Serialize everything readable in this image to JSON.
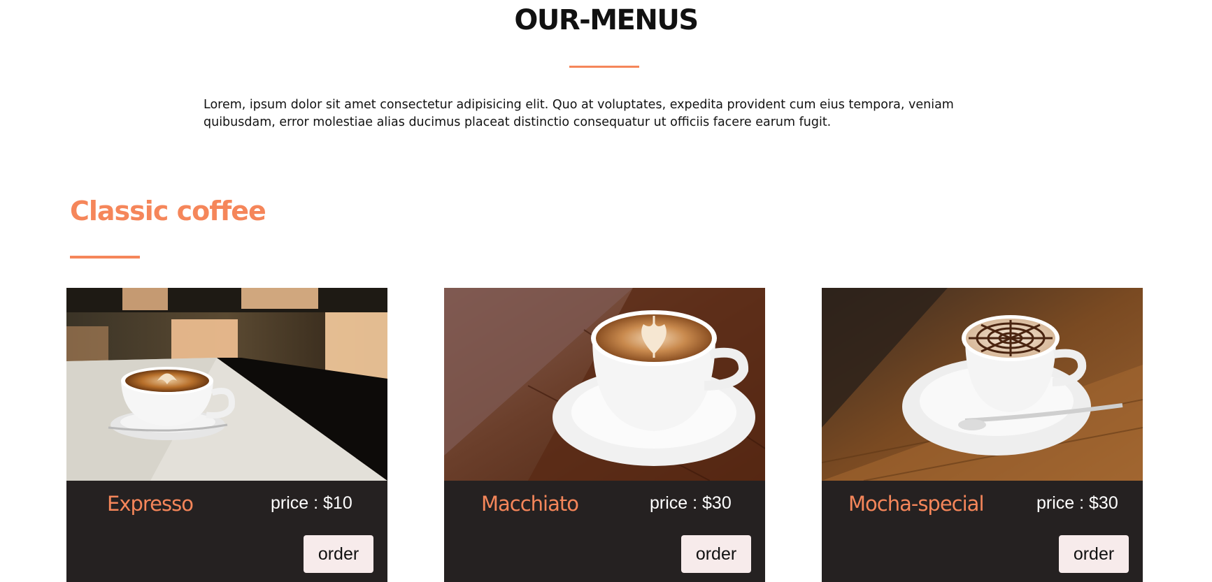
{
  "section": {
    "title": "OUR-MENUS",
    "intro": "Lorem, ipsum dolor sit amet consectetur adipisicing elit. Quo at voluptates, expedita provident cum eius tempora, veniam quibusdam, error molestiae alias ducimus placeat distinctio consequatur ut officiis facere earum fugit."
  },
  "category": {
    "title": "Classic coffee",
    "items": [
      {
        "name": "Expresso",
        "price": "price : $10",
        "order_label": "order",
        "image": "espresso-latte-art-cup-photo"
      },
      {
        "name": "Macchiato",
        "price": "price : $30",
        "order_label": "order",
        "image": "macchiato-latte-art-cup-photo"
      },
      {
        "name": "Mocha-special",
        "price": "price : $30",
        "order_label": "order",
        "image": "mocha-spiderweb-cup-photo"
      }
    ]
  },
  "colors": {
    "accent": "#f5865a",
    "card_background": "#252121",
    "button_background": "#f7ebeb",
    "text": "#111111"
  }
}
